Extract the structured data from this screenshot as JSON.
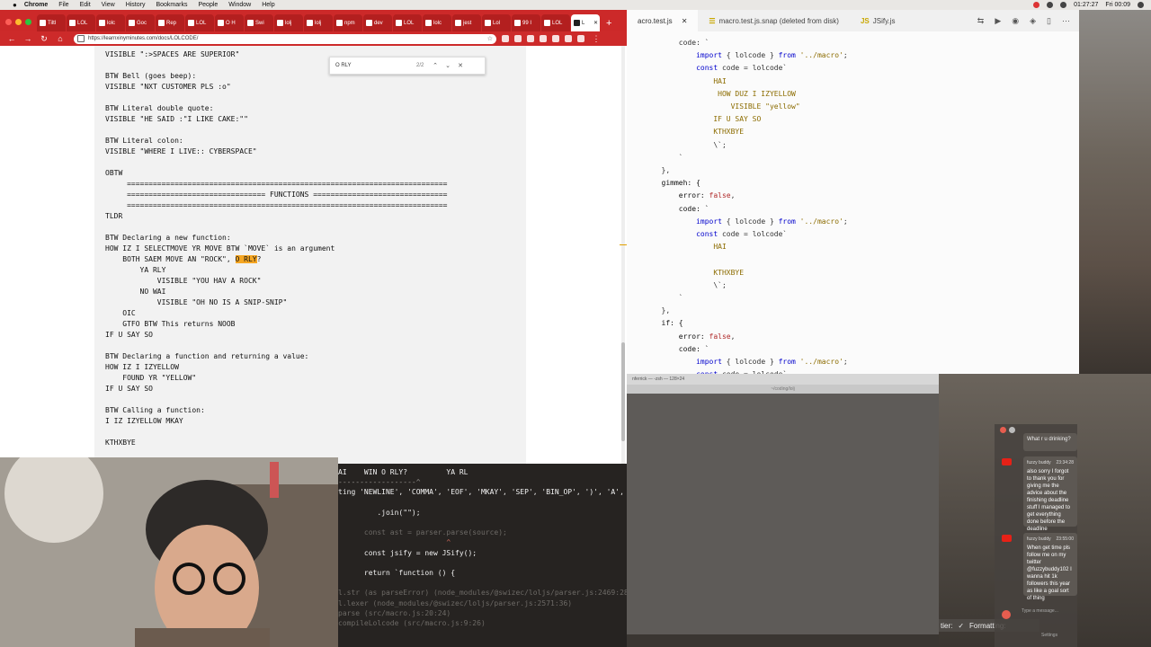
{
  "menubar": {
    "app": "Chrome",
    "items": [
      "File",
      "Edit",
      "View",
      "History",
      "Bookmarks",
      "People",
      "Window",
      "Help"
    ],
    "time": "01:27:27",
    "date": "Fri 00:09"
  },
  "browser": {
    "tabs": [
      {
        "label": "Tiltl"
      },
      {
        "label": "LOL"
      },
      {
        "label": "lolc"
      },
      {
        "label": "Goc"
      },
      {
        "label": "Rep"
      },
      {
        "label": "LOL"
      },
      {
        "label": "O H"
      },
      {
        "label": "Swi"
      },
      {
        "label": "lolj"
      },
      {
        "label": "lolj"
      },
      {
        "label": "npm"
      },
      {
        "label": "dev"
      },
      {
        "label": "LOL"
      },
      {
        "label": "lolc"
      },
      {
        "label": "jest"
      },
      {
        "label": "Lol"
      },
      {
        "label": "99 I"
      },
      {
        "label": "LOL"
      },
      {
        "label": "L"
      }
    ],
    "url": "https://learnxinyminutes.com/docs/LOLCODE/",
    "find": {
      "query": "O RLY",
      "count": "2/2"
    }
  },
  "article": {
    "code_lines": [
      "VISIBLE \":>SPACES ARE SUPERIOR\"",
      "",
      "BTW Bell (goes beep):",
      "VISIBLE \"NXT CUSTOMER PLS :o\"",
      "",
      "BTW Literal double quote:",
      "VISIBLE \"HE SAID :\"I LIKE CAKE:\"\"",
      "",
      "BTW Literal colon:",
      "VISIBLE \"WHERE I LIVE:: CYBERSPACE\"",
      "",
      "OBTW",
      "     ==========================================================================",
      "     ================================ FUNCTIONS ===============================",
      "     ==========================================================================",
      "TLDR",
      "",
      "BTW Declaring a new function:",
      "HOW IZ I SELECTMOVE YR MOVE BTW `MOVE` is an argument",
      "    BOTH SAEM MOVE AN \"ROCK\", ",
      "        YA RLY",
      "            VISIBLE \"YOU HAV A ROCK\"",
      "        NO WAI",
      "            VISIBLE \"OH NO IS A SNIP-SNIP\"",
      "    OIC",
      "    GTFO BTW This returns NOOB",
      "IF U SAY SO",
      "",
      "BTW Declaring a function and returning a value:",
      "HOW IZ I IZYELLOW",
      "    FOUND YR \"YELLOW\"",
      "IF U SAY SO",
      "",
      "BTW Calling a function:",
      "I IZ IZYELLOW MKAY",
      "",
      "KTHXBYE"
    ],
    "highlight": "O RLY",
    "highlight_tail": "?"
  },
  "editor": {
    "tabs": [
      {
        "label": "acro.test.js",
        "active": true
      },
      {
        "label": "macro.test.js.snap (deleted from disk)",
        "active": false
      },
      {
        "label": "JSify.js",
        "active": false
      }
    ]
  },
  "terminal": {
    "title": "nferrick — -zsh — 128×24",
    "path": "~/coding/lolj"
  },
  "console": {
    "lines": [
      {
        "text": "AI    WIN O RLY?         YA RL",
        "cls": "t-w"
      },
      {
        "text": "------------------^",
        "cls": "t-g"
      },
      {
        "text": "ting 'NEWLINE', 'COMMA', 'EOF', 'MKAY', 'SEP', 'BIN_OP', ')', 'A', '!', got 'O_RLY'",
        "cls": "t-w"
      },
      {
        "text": "",
        "cls": "t-w"
      },
      {
        "text": "         .join(\"\");",
        "cls": "t-w"
      },
      {
        "text": "",
        "cls": "t-w"
      },
      {
        "text": "      const ast = parser.parse(source);",
        "cls": "t-d"
      },
      {
        "text": "                         ^",
        "cls": "t-r"
      },
      {
        "text": "      const jsify = new JSify();",
        "cls": "t-w"
      },
      {
        "text": "",
        "cls": "t-w"
      },
      {
        "text": "      return `function () {",
        "cls": "t-w"
      },
      {
        "text": "",
        "cls": "t-w"
      },
      {
        "text": "l.str (as parseError) (node_modules/@swizec/loljs/parser.js:2469:28)",
        "cls": "t-d"
      },
      {
        "text": "l.lexer (node_modules/@swizec/loljs/parser.js:2571:36)",
        "cls": "t-d"
      },
      {
        "text": "parse (src/macro.js:20:24)",
        "cls": "t-d"
      },
      {
        "text": "compileLolcode (src/macro.js:9:26)",
        "cls": "t-d"
      }
    ]
  },
  "statusbar": {
    "left": "tier:",
    "formatting": "Formatting:",
    "check": "✓"
  },
  "chat": {
    "top_message": "What r u drinking?",
    "messages": [
      {
        "author": "fuzzy buddy",
        "time": "23:34:28",
        "text": "also sorry I forgot to thank you for giving me the advice about the finishing deadline stuff I managed to get everything done before the deadline"
      },
      {
        "author": "fuzzy buddy",
        "time": "23:55:00",
        "text": "When get time pls follow me on my twitter @fuzzybuddy102 I wanna hit 1k followers this year as like a goal sort of thing"
      }
    ],
    "input_placeholder": "Type a message...",
    "settings": "Settings"
  },
  "colors": {
    "chrome_red": "#cc2929",
    "find_highlight": "#f5a623",
    "youtube_red": "#e62117"
  }
}
